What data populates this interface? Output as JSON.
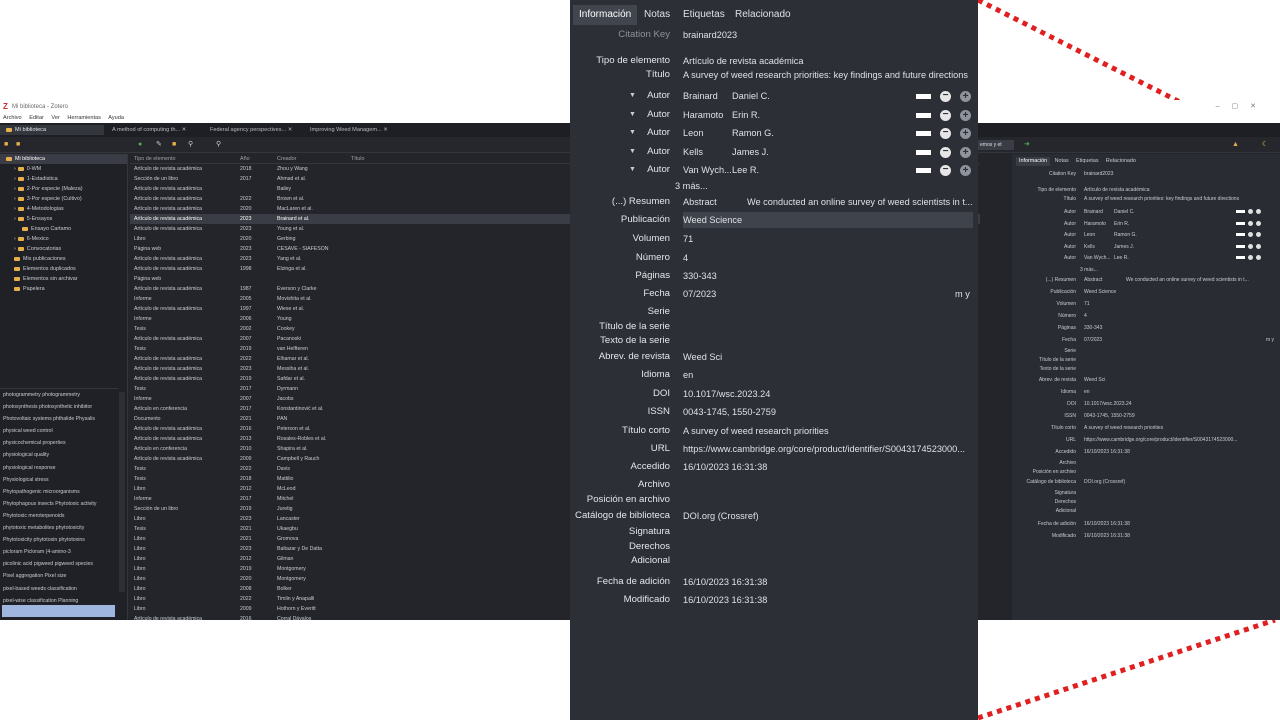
{
  "window": {
    "title": "Mi biblioteca - Zotero",
    "controls": [
      "–",
      "▢",
      "✕"
    ]
  },
  "menu": [
    "Archivo",
    "Editar",
    "Ver",
    "Herramientas",
    "Ayuda"
  ],
  "tabs": [
    {
      "label": "Mi biblioteca"
    },
    {
      "label": "A method of computing th..."
    },
    {
      "label": "Federal agency perspectives..."
    },
    {
      "label": "Improving Weed Managem..."
    }
  ],
  "search": {
    "value": "emos y et"
  },
  "collections": [
    {
      "label": "Mi biblioteca",
      "depth": 0
    },
    {
      "label": "0-WM",
      "depth": 1
    },
    {
      "label": "1-Estadistica",
      "depth": 1
    },
    {
      "label": "2-Por especie (Maleza)",
      "depth": 1
    },
    {
      "label": "3-Por especie (Cultivo)",
      "depth": 1
    },
    {
      "label": "4-Metodologias",
      "depth": 1
    },
    {
      "label": "5-Ensayos",
      "depth": 1
    },
    {
      "label": "Ensayo Cartamo",
      "depth": 2
    },
    {
      "label": "6-Mexico",
      "depth": 1
    },
    {
      "label": "Convocatorias",
      "depth": 1
    },
    {
      "label": "Mis publicaciones",
      "depth": 1
    },
    {
      "label": "Elementos duplicados",
      "depth": 1
    },
    {
      "label": "Elementos sin archivar",
      "depth": 1
    },
    {
      "label": "Papelera",
      "depth": 1
    }
  ],
  "tags": [
    "photogrammetry   photogrammetry",
    "photosynthesis   photosynthetic inhibitor",
    "Photovoltaic systems   phthalide   Physalis",
    "physical weed control",
    "physicochemical properties",
    "physiological quality",
    "physiological response",
    "Physiological stress",
    "Phytopathogenic microorganisms",
    "Phytophagous insects   Phytotoxic activity",
    "Phytotoxic meroterpenoids",
    "phytotoxic metabolites   phytotoxicity",
    "Phytotoxicity   phytotoxin   phytotoxins",
    "picloram   Picloram (4-amino-3",
    "picolinic acid   pigweed   pigweed species",
    "Pixel aggregation   Pixel size",
    "pixel-based weeds classification",
    "pixel-wise classification   Planning"
  ],
  "items_header": {
    "type": "Tipo de elemento",
    "year": "Año",
    "creator": "Creador",
    "title": "Título"
  },
  "items": [
    {
      "type": "Artículo de revista académica",
      "year": "2018",
      "creator": "Zhou y Wang",
      "title": "A new nonlinear method for calculating growing degree days"
    },
    {
      "type": "Sección de un libro",
      "year": "2017",
      "creator": "Ahmad et al.",
      "title": "Growing Degree Days to Forecast Crop Stages"
    },
    {
      "type": "Artículo de revista académica",
      "year": "",
      "creator": "Bailey",
      "title": "Using Growing Degree Days to Predict Plant Stages"
    },
    {
      "type": "Artículo de revista académica",
      "year": "2022",
      "creator": "Brown et al.",
      "title": "Improving Weed Management Based on the Timing of Emergence Peaks: A C"
    },
    {
      "type": "Artículo de revista académica",
      "year": "2020",
      "creator": "MacLaren et al.",
      "title": "An ecological future for weed science to sustain crop production and the en"
    },
    {
      "type": "Artículo de revista académica",
      "year": "2023",
      "creator": "Brainard et al.",
      "title": "A survey of weed research priorities: key findings and future directions"
    },
    {
      "type": "Artículo de revista académica",
      "year": "2023",
      "creator": "Young et al.",
      "title": "Federal agency perspectives and funding opportunities for weed and invasive"
    },
    {
      "type": "Libro",
      "year": "2020",
      "creator": "Gerbing",
      "title": "R Visualizations: Derive Meaning from Data"
    },
    {
      "type": "Página web",
      "year": "2023",
      "creator": "CESAVE - SIAFESON",
      "title": "Red de Estaciones Meteorológicas Automáticas de Sonora"
    },
    {
      "type": "Artículo de revista académica",
      "year": "2023",
      "creator": "Yang et al.",
      "title": "Cross-Platform Wheat Ear Counting Model Using Deep Learning for UAV and"
    },
    {
      "type": "Artículo de revista académica",
      "year": "1998",
      "creator": "Elzinga et al.",
      "title": "Measuring & Monitoring Plant Populations"
    },
    {
      "type": "Página web",
      "year": "",
      "creator": "",
      "title": "Point Intercept"
    },
    {
      "type": "Artículo de revista académica",
      "year": "1987",
      "creator": "Everson y Clarke",
      "title": "A comparison of six methods of botanical analysis in the montane grassland"
    },
    {
      "type": "Informe",
      "year": "2005",
      "creator": "Movishita et al.",
      "title": "Field Bindweed Convolvulus arvensis L.: Convolvulaceae"
    },
    {
      "type": "Artículo de revista académica",
      "year": "1997",
      "creator": "Wiese et al.",
      "title": "Economic evaluation of field bindweed ( Convolvulus arvensis ) control"
    },
    {
      "type": "Informe",
      "year": "2006",
      "creator": "Young",
      "title": "The history of the US department of defense programs for the testing, evalua"
    },
    {
      "type": "Tesis",
      "year": "2002",
      "creator": "Cookey",
      "title": "Invasive plant mapping: A standardized system"
    },
    {
      "type": "Artículo de revista académica",
      "year": "2007",
      "creator": "Pacanoski",
      "title": "Herbicide use: Benefits for society as a whole- a review"
    },
    {
      "type": "Tesis",
      "year": "2019",
      "creator": "van Helfteren",
      "title": "Comparing UAV-based image resolution to deep-learning weed-detection p"
    },
    {
      "type": "Artículo de revista académica",
      "year": "2022",
      "creator": "Elhamar et al.",
      "title": "The effect of plant extracts on shikimik pathway in weeds Avena fatua Brome"
    },
    {
      "type": "Artículo de revista académica",
      "year": "2023",
      "creator": "Messiha et al.",
      "title": "The Dual Allelopathic Efficiency of Bougainvillea Glabra Leaf Powder on The"
    },
    {
      "type": "Artículo de revista académica",
      "year": "2019",
      "creator": "Safdar et al.",
      "title": "Etimation of economic threshold of convolvulus arvensis L. weed in wheat (T"
    },
    {
      "type": "Tesis",
      "year": "2017",
      "creator": "Dyrmann",
      "title": "Automatic detection and classification of weed seedlings under natural light"
    },
    {
      "type": "Informe",
      "year": "2007",
      "creator": "Jacobs",
      "title": "Ecology and Management of field bindweed [Convolvulus arvensis L.]"
    },
    {
      "type": "Artículo en conferencia",
      "year": "2017",
      "creator": "Konstantinović et al.",
      "title": "LLELOPATHIC EFFECT OF Cannabis sativa L. ESSENTIAL OIL ON INITIAL GROV"
    },
    {
      "type": "Documento",
      "year": "2021",
      "creator": "PAN",
      "title": "PAN International List of Highly Hazardous Pesticides"
    },
    {
      "type": "Artículo de revista académica",
      "year": "2016",
      "creator": "Peterson et al.",
      "title": "2,4-D Past, Present, and Future: A Review"
    },
    {
      "type": "Artículo de revista académica",
      "year": "2013",
      "creator": "Rosales-Robles et al.",
      "title": "El tipo de boquilla no afecta la efectividad de los herbicidas prosulfuron, bron"
    },
    {
      "type": "Artículo en conferencia",
      "year": "2010",
      "creator": "Shapira et al.",
      "title": "Weeds-detection-by-ground-level-hyperspectral-data.pdf"
    },
    {
      "type": "Artículo de revista académica",
      "year": "2009",
      "creator": "Campbell y Rauch",
      "title": "Proceedings of the Wester Society of Weed Science"
    },
    {
      "type": "Tesis",
      "year": "2022",
      "creator": "Davis",
      "title": "Precision Weed Management Based on UAS Image Streams, Machine Learnin"
    },
    {
      "type": "Tesis",
      "year": "2018",
      "creator": "Mattilio",
      "title": "Remote Mapping and Spatial Modeling for Noxious Weed Management in th"
    },
    {
      "type": "Libro",
      "year": "2012",
      "creator": "McLeod",
      "title": "Annual Costs of Weeds in Australia"
    },
    {
      "type": "Informe",
      "year": "2017",
      "creator": "Mitchel",
      "title": "Herbicide efficacy evaluation"
    },
    {
      "type": "Sección de un libro",
      "year": "2019",
      "creator": "Juretig",
      "title": "R statistics cookbook over 100 recipes for performing complex statistical ope"
    },
    {
      "type": "Libro",
      "year": "2023",
      "creator": "Lancaster",
      "title": "2023 Chemical Weed Control for Field Crops, Pastures, Rangeland, and Nonc"
    },
    {
      "type": "Tesis",
      "year": "2021",
      "creator": "Ukaegbu",
      "title": "Development of a smart weed detector and selective herbicide sprayer"
    },
    {
      "type": "Libro",
      "year": "2021",
      "creator": "Gromova",
      "title": "Weed Detection in UAV Images of Cereal Crops with Instance Segmentation"
    },
    {
      "type": "Libro",
      "year": "2023",
      "creator": "Baltazar y De Datta",
      "title": "Weed science and weed management in rice and cereal-based cropping syst"
    },
    {
      "type": "Libro",
      "year": "2012",
      "creator": "Gilman",
      "title": "Organic soil-fertility and weed management"
    },
    {
      "type": "Libro",
      "year": "2019",
      "creator": "Montgomery",
      "title": "Supplemental text material for design and analysis of experiments"
    },
    {
      "type": "Libro",
      "year": "2020",
      "creator": "Montgomery",
      "title": "Design and analysis of experiments"
    },
    {
      "type": "Libro",
      "year": "2008",
      "creator": "Bolker",
      "title": "Ecological models and data in R"
    },
    {
      "type": "Libro",
      "year": "2022",
      "creator": "Timlin y Anapalli",
      "title": "Enhancing agricultural research and precision management for subsistence f"
    },
    {
      "type": "Libro",
      "year": "2009",
      "creator": "Hothorn y Everitt",
      "title": "A handbook of statistical analyses using R"
    },
    {
      "type": "Artículo de revista académica",
      "year": "2016",
      "creator": "Corral Dávalos",
      "title": "Estadística y técnicas experimentales para la investigación biológica"
    }
  ],
  "item_pane": {
    "tabs": [
      "Información",
      "Notas",
      "Etiquetas",
      "Relacionado"
    ],
    "citation_key_label": "Citation Key",
    "citation_key": "brainard2023",
    "fields": {
      "item_type_label": "Tipo de elemento",
      "item_type": "Artículo de revista académica",
      "title_label": "Título",
      "title": "A survey of weed research priorities: key findings and future directions",
      "author_label": "Autor",
      "authors": [
        {
          "last": "Brainard",
          "first": "Daniel C."
        },
        {
          "last": "Haramoto",
          "first": "Erin R."
        },
        {
          "last": "Leon",
          "first": "Ramon G."
        },
        {
          "last": "Kells",
          "first": "James J."
        },
        {
          "last": "Van Wych...",
          "first": "Lee R."
        }
      ],
      "more_authors": "3 más...",
      "abstract_label": "(...) Resumen",
      "abstract_prefix": "Abstract",
      "abstract": "We conducted an online survey of weed scientists in t...",
      "publication_label": "Publicación",
      "publication": "Weed Science",
      "volume_label": "Volumen",
      "volume": "71",
      "issue_label": "Número",
      "issue": "4",
      "pages_label": "Páginas",
      "pages": "330-343",
      "date_label": "Fecha",
      "date": "07/2023",
      "date_format": "m y",
      "series_label": "Serie",
      "series_title_label": "Título de la serie",
      "series_text_label": "Texto de la serie",
      "journal_abbr_label": "Abrev. de revista",
      "journal_abbr": "Weed Sci",
      "language_label": "Idioma",
      "language": "en",
      "doi_label": "DOI",
      "doi": "10.1017/wsc.2023.24",
      "issn_label": "ISSN",
      "issn": "0043-1745, 1550-2759",
      "short_title_label": "Título corto",
      "short_title": "A survey of weed research priorities",
      "url_label": "URL",
      "url": "https://www.cambridge.org/core/product/identifier/S0043174523000...",
      "accessed_label": "Accedido",
      "accessed": "16/10/2023 16:31:38",
      "archive_label": "Archivo",
      "archive_location_label": "Posición en archivo",
      "library_catalog_label": "Catálogo de biblioteca",
      "library_catalog": "DOI.org (Crossref)",
      "call_number_label": "Signatura",
      "rights_label": "Derechos",
      "extra_label": "Adicional",
      "date_added_label": "Fecha de adición",
      "date_added": "16/10/2023 16:31:38",
      "modified_label": "Modificado",
      "modified": "16/10/2023 16:31:38"
    }
  },
  "colors": {
    "callout": "#e02020",
    "pane_bg": "#2c2f36",
    "highlight": "#3f434c",
    "folder": "#e8b04b"
  }
}
